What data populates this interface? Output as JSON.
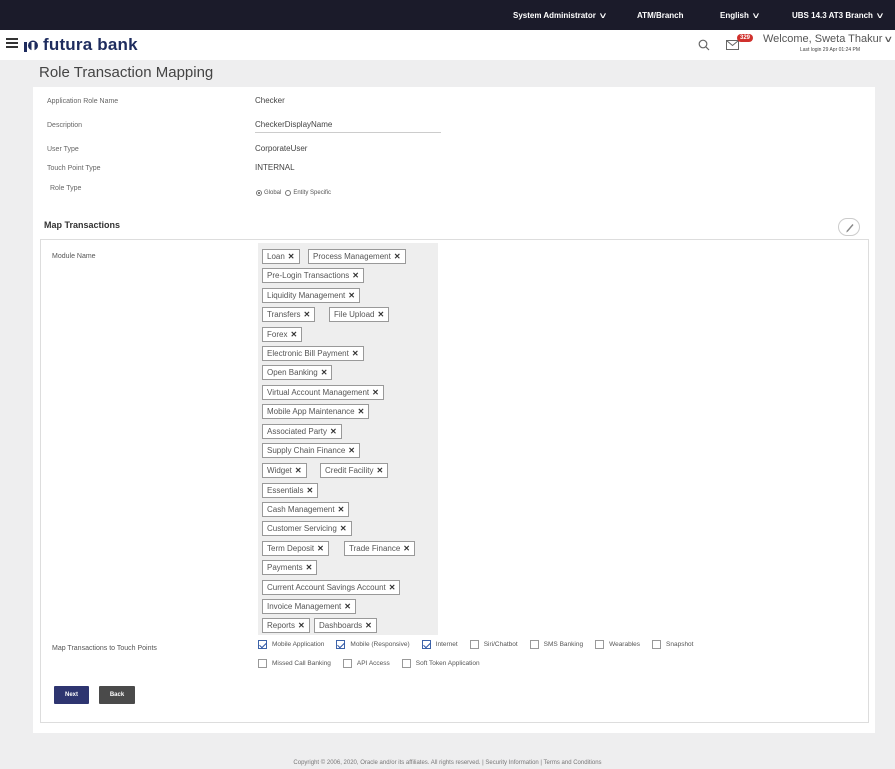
{
  "topbar": {
    "user_role": "System Administrator",
    "channel": "ATM/Branch",
    "language": "English",
    "branch": "UBS 14.3 AT3 Branch"
  },
  "header": {
    "logo_text": "futura bank",
    "notification_count": "329",
    "welcome": "Welcome, Sweta Thakur",
    "last_login": "Last login 29 Apr 01:24 PM"
  },
  "page": {
    "title": "Role Transaction Mapping"
  },
  "form": {
    "app_role_label": "Application Role Name",
    "app_role_value": "Checker",
    "description_label": "Description",
    "description_value": "CheckerDisplayName",
    "user_type_label": "User Type",
    "user_type_value": "CorporateUser",
    "touch_point_type_label": "Touch Point Type",
    "touch_point_type_value": "INTERNAL",
    "role_type_label": "Role Type",
    "role_type_options": [
      "Global",
      "Entity Specific"
    ],
    "role_type_selected": "Global"
  },
  "map_transactions": {
    "title": "Map Transactions",
    "module_name_label": "Module Name",
    "modules": [
      "Loan",
      "Process Management",
      "Pre-Login Transactions",
      "Liquidity Management",
      "Transfers",
      "File Upload",
      "Forex",
      "Electronic Bill Payment",
      "Open Banking",
      "Virtual Account Management",
      "Mobile App Maintenance",
      "Associated Party",
      "Supply Chain Finance",
      "Widget",
      "Credit Facility",
      "Essentials",
      "Cash Management",
      "Customer Servicing",
      "Term Deposit",
      "Trade Finance",
      "Payments",
      "Current Account Savings Account",
      "Invoice Management",
      "Reports",
      "Dashboards"
    ],
    "touch_points_label": "Map Transactions to Touch Points",
    "touch_points": [
      {
        "label": "Mobile Application",
        "checked": true
      },
      {
        "label": "Mobile (Responsive)",
        "checked": true
      },
      {
        "label": "Internet",
        "checked": true
      },
      {
        "label": "Siri/Chatbot",
        "checked": false
      },
      {
        "label": "SMS Banking",
        "checked": false
      },
      {
        "label": "Wearables",
        "checked": false
      },
      {
        "label": "Snapshot",
        "checked": false
      },
      {
        "label": "Missed Call Banking",
        "checked": false
      },
      {
        "label": "API Access",
        "checked": false
      },
      {
        "label": "Soft Token Application",
        "checked": false
      }
    ]
  },
  "buttons": {
    "next": "Next",
    "back": "Back"
  },
  "footer": {
    "text": "Copyright © 2006, 2020, Oracle and/or its affiliates. All rights reserved. | Security Information | Terms and Conditions"
  },
  "colors": {
    "topbar_bg": "#1b1b2a",
    "brand": "#1e2c5e",
    "primary_button": "#2e3570",
    "secondary_button": "#4a4a4a",
    "badge": "#d0312d",
    "checkbox_checked": "#2d56a6"
  }
}
